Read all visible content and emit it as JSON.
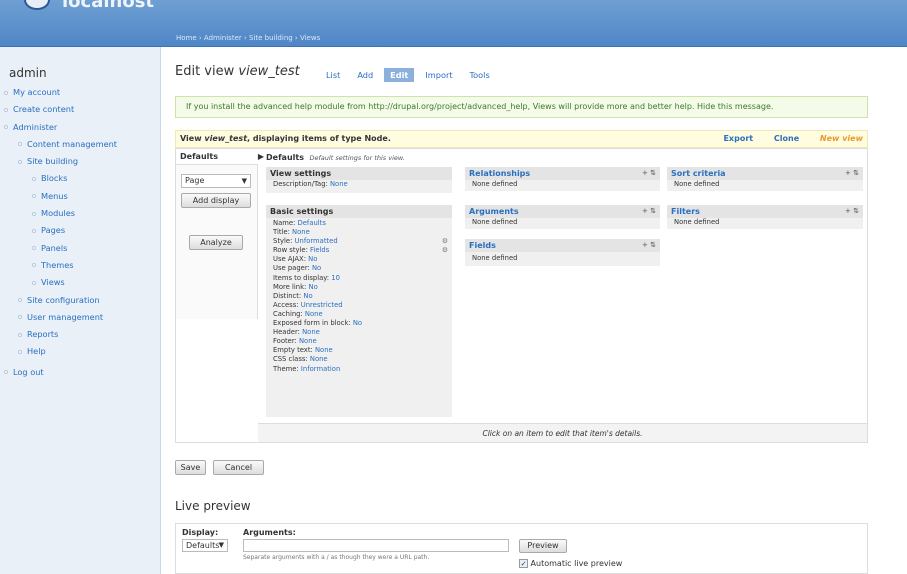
{
  "site": {
    "name": "localhost"
  },
  "breadcrumb": "Home › Administer › Site building › Views",
  "sidebar": {
    "user": "admin",
    "items": [
      {
        "label": "My account",
        "indent": 0
      },
      {
        "label": "Create content",
        "indent": 0
      },
      {
        "label": "Administer",
        "indent": 0
      },
      {
        "label": "Content management",
        "indent": 1
      },
      {
        "label": "Site building",
        "indent": 1
      },
      {
        "label": "Blocks",
        "indent": 2
      },
      {
        "label": "Menus",
        "indent": 2
      },
      {
        "label": "Modules",
        "indent": 2
      },
      {
        "label": "Pages",
        "indent": 2
      },
      {
        "label": "Panels",
        "indent": 2
      },
      {
        "label": "Themes",
        "indent": 2
      },
      {
        "label": "Views",
        "indent": 2
      },
      {
        "label": "Site configuration",
        "indent": 1
      },
      {
        "label": "User management",
        "indent": 1
      },
      {
        "label": "Reports",
        "indent": 1
      },
      {
        "label": "Help",
        "indent": 1
      },
      {
        "label": "Log out",
        "indent": 0
      }
    ]
  },
  "page": {
    "title_prefix": "Edit view ",
    "title_name": "view_test",
    "tabs": [
      "List",
      "Add",
      "Edit",
      "Import",
      "Tools"
    ],
    "active_tab": "Edit"
  },
  "help_message": "If you install the advanced help module from http://drupal.org/project/advanced_help, Views will provide more and better help. Hide this message.",
  "view_header": {
    "text_a": "View ",
    "name": "view_test",
    "text_b": ", displaying items of type Node.",
    "export": "Export",
    "clone": "Clone",
    "new_view": "New view"
  },
  "editor": {
    "defaults_tab": "Defaults",
    "display_select": "Page",
    "add_display": "Add display",
    "analyze": "Analyze",
    "subhead_title": "Defaults",
    "subhead_note": "Default settings for this view.",
    "view_settings_title": "View settings",
    "view_settings": [
      {
        "k": "Description/Tag: ",
        "v": "None"
      }
    ],
    "basic_settings_title": "Basic settings",
    "basic_settings": [
      {
        "k": "Name: ",
        "v": "Defaults"
      },
      {
        "k": "Title: ",
        "v": "None"
      },
      {
        "k": "Style: ",
        "v": "Unformatted"
      },
      {
        "k": "Row style: ",
        "v": "Fields"
      },
      {
        "k": "Use AJAX: ",
        "v": "No"
      },
      {
        "k": "Use pager: ",
        "v": "No"
      },
      {
        "k": "Items to display: ",
        "v": "10"
      },
      {
        "k": "More link: ",
        "v": "No"
      },
      {
        "k": "Distinct: ",
        "v": "No"
      },
      {
        "k": "Access: ",
        "v": "Unrestricted"
      },
      {
        "k": "Caching: ",
        "v": "None"
      },
      {
        "k": "Exposed form in block: ",
        "v": "No"
      },
      {
        "k": "Header: ",
        "v": "None"
      },
      {
        "k": "Footer: ",
        "v": "None"
      },
      {
        "k": "Empty text: ",
        "v": "None"
      },
      {
        "k": "CSS class: ",
        "v": "None"
      },
      {
        "k": "Theme: ",
        "v": "Information"
      }
    ],
    "relationships_title": "Relationships",
    "arguments_title": "Arguments",
    "fields_title": "Fields",
    "sort_title": "Sort criteria",
    "filters_title": "Filters",
    "none_defined": "None defined",
    "panel_icons": "+ ⇅",
    "status_text": "Click on an item to edit that item's details."
  },
  "form": {
    "save": "Save",
    "cancel": "Cancel"
  },
  "live_preview": {
    "title": "Live preview",
    "display_label": "Display:",
    "display_value": "Defaults",
    "arguments_label": "Arguments:",
    "arguments_help": "Separate arguments with a / as though they were a URL path.",
    "preview_button": "Preview",
    "auto_label": "Automatic live preview"
  },
  "colors": {
    "link": "#2a6fc0",
    "header": "#4f86c7",
    "new_view": "#e69a2e",
    "help_green": "#3a7a2a"
  }
}
